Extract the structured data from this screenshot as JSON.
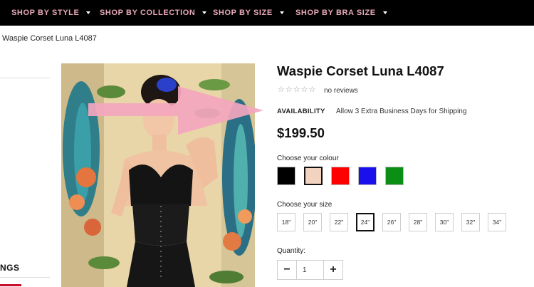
{
  "nav": {
    "items": [
      {
        "label": "SHOP BY STYLE"
      },
      {
        "label": "SHOP BY COLLECTION"
      },
      {
        "label": "SHOP BY SIZE"
      },
      {
        "label": "SHOP BY BRA SIZE"
      }
    ],
    "text_color": "#e8a9b8",
    "background": "#000000"
  },
  "breadcrumb": "Waspie Corset Luna L4087",
  "sidebar": {
    "heading": "NGS"
  },
  "product": {
    "title": "Waspie Corset Luna L4087",
    "rating": 0,
    "rating_max": 5,
    "reviews_text": "no reviews",
    "availability_label": "AVAILABILITY",
    "availability_value": "Allow 3 Extra Business Days for Shipping",
    "price": "$199.50",
    "colour_label": "Choose your colour",
    "colours": [
      {
        "hex": "#000000",
        "selected": false
      },
      {
        "hex": "#f2d3c0",
        "selected": true
      },
      {
        "hex": "#ff0000",
        "selected": false
      },
      {
        "hex": "#1a10ee",
        "selected": false
      },
      {
        "hex": "#0a8f14",
        "selected": false
      }
    ],
    "size_label": "Choose your size",
    "sizes": [
      {
        "label": "18\"",
        "selected": false
      },
      {
        "label": "20\"",
        "selected": false
      },
      {
        "label": "22\"",
        "selected": false
      },
      {
        "label": "24\"",
        "selected": true
      },
      {
        "label": "26\"",
        "selected": false
      },
      {
        "label": "28\"",
        "selected": false
      },
      {
        "label": "30\"",
        "selected": false
      },
      {
        "label": "32\"",
        "selected": false
      },
      {
        "label": "34\"",
        "selected": false
      }
    ],
    "quantity_label": "Quantity:",
    "quantity_value": "1",
    "minus_symbol": "−",
    "plus_symbol": "+"
  },
  "annotation": {
    "arrow_color": "#f4a6bf"
  }
}
